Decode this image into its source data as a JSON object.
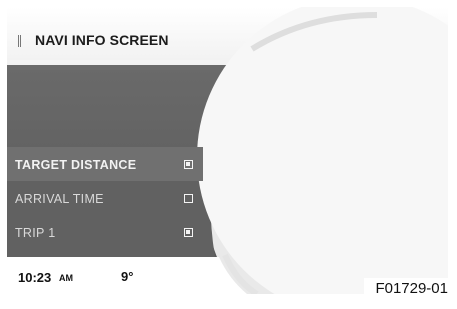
{
  "header": {
    "title": "NAVI INFO SCREEN"
  },
  "menu": {
    "items": [
      {
        "label": "TARGET DISTANCE",
        "checked": true,
        "selected": true
      },
      {
        "label": "ARRIVAL TIME",
        "checked": false,
        "selected": false
      },
      {
        "label": "TRIP 1",
        "checked": true,
        "selected": false
      }
    ]
  },
  "status": {
    "time": "10:23",
    "ampm": "AM",
    "temperature": "9°"
  },
  "figure_ref": "F01729-01"
}
